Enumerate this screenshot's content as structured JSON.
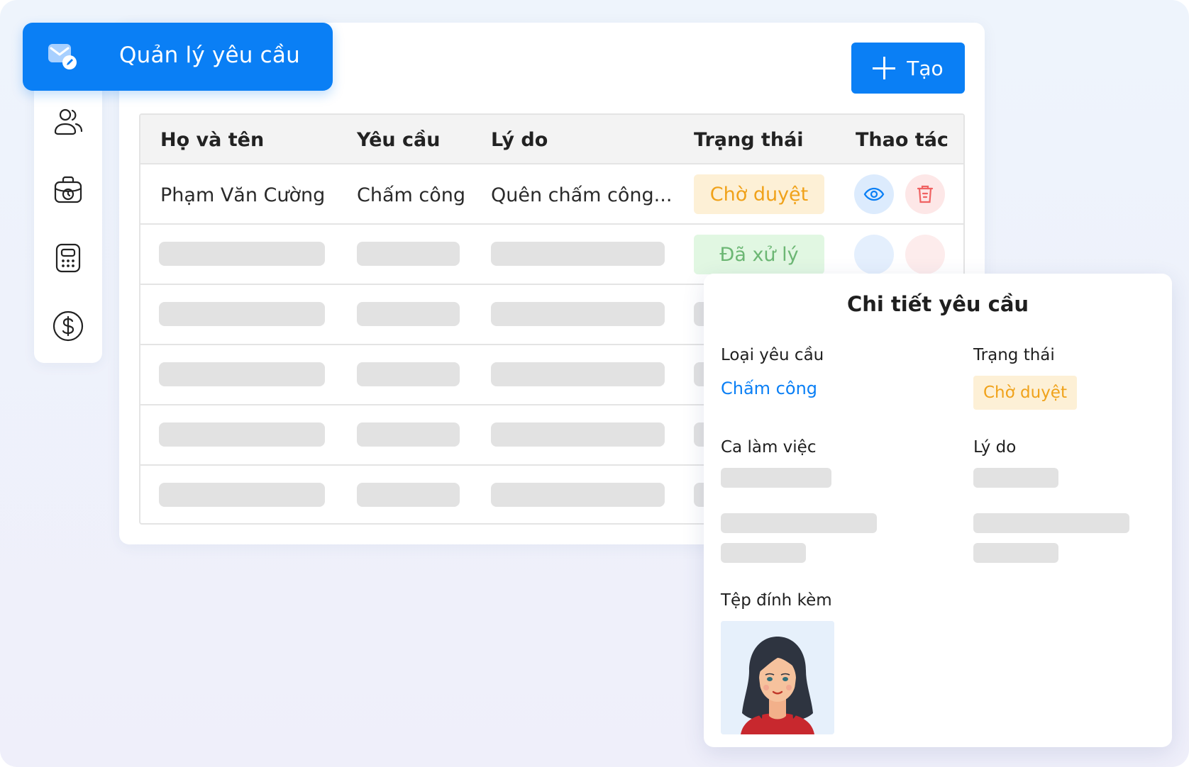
{
  "app": {
    "title": "Quản lý yêu cầu",
    "accent": "#0a7ff5"
  },
  "sidebar": {
    "items": [
      {
        "icon": "users-icon"
      },
      {
        "icon": "briefcase-clock-icon"
      },
      {
        "icon": "calculator-icon"
      },
      {
        "icon": "dollar-icon"
      }
    ]
  },
  "toolbar": {
    "create_label": "Tạo"
  },
  "table": {
    "headers": [
      "Họ và tên",
      "Yêu cầu",
      "Lý do",
      "Trạng thái",
      "Thao tác"
    ],
    "first_row": {
      "name": "Phạm Văn Cường",
      "request": "Chấm công",
      "reason": "Quên chấm công...",
      "status": "Chờ duyệt"
    },
    "second_row_status": "Đã xử lý"
  },
  "detail": {
    "title": "Chi tiết yêu cầu",
    "type_label": "Loại yêu cầu",
    "type_value": "Chấm công",
    "status_label": "Trạng thái",
    "status_value": "Chờ duyệt",
    "shift_label": "Ca làm việc",
    "reason_label": "Lý do",
    "attachment_label": "Tệp đính kèm"
  },
  "colors": {
    "pending_bg": "#fdf0d6",
    "pending_text": "#f0a21a",
    "done_bg": "#e1f7e2",
    "done_text": "#6cb774",
    "skeleton": "#e2e2e2"
  }
}
